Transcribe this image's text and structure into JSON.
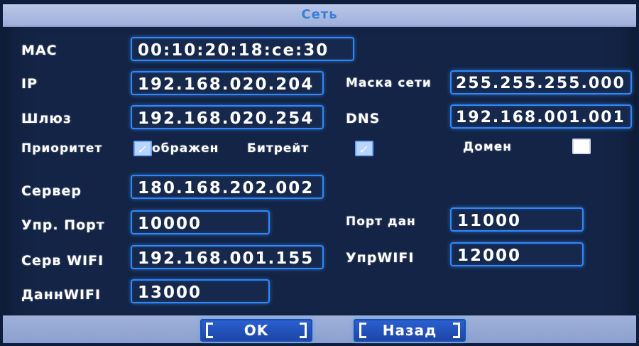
{
  "window": {
    "title": "Сеть"
  },
  "labels": {
    "mac": "MAC",
    "ip": "IP",
    "mask": "Маска сети",
    "gateway": "Шлюз",
    "dns": "DNS",
    "priority": "Приоритет",
    "image": "ображен",
    "bitrate": "Битрейт",
    "domain": "Домен",
    "server": "Сервер",
    "ctrl_port": "Упр. Порт",
    "data_port": "Порт дан",
    "serv_wifi": "Серв WIFI",
    "ctrl_wifi": "УпрWIFI",
    "data_wifi": "ДаннWIFI"
  },
  "fields": {
    "mac": "00:10:20:18:ce:30",
    "ip": "192.168.020.204",
    "mask": "255.255.255.000",
    "gateway": "192.168.020.254",
    "dns": "192.168.001.001",
    "server": "180.168.202.002",
    "ctrl_port": "10000",
    "data_port": "11000",
    "serv_wifi": "192.168.001.155",
    "ctrl_wifi": "12000",
    "data_wifi": "13000"
  },
  "checkboxes": {
    "image_checked": true,
    "bitrate_checked": true,
    "domain_checked": false,
    "check_glyph": "✓"
  },
  "buttons": {
    "ok": "OK",
    "back": "Назад"
  },
  "colors": {
    "background": "#132446",
    "field_border": "#2f86ff",
    "title_bar": "#b9c7e8",
    "title_text": "#3a7fd6"
  }
}
